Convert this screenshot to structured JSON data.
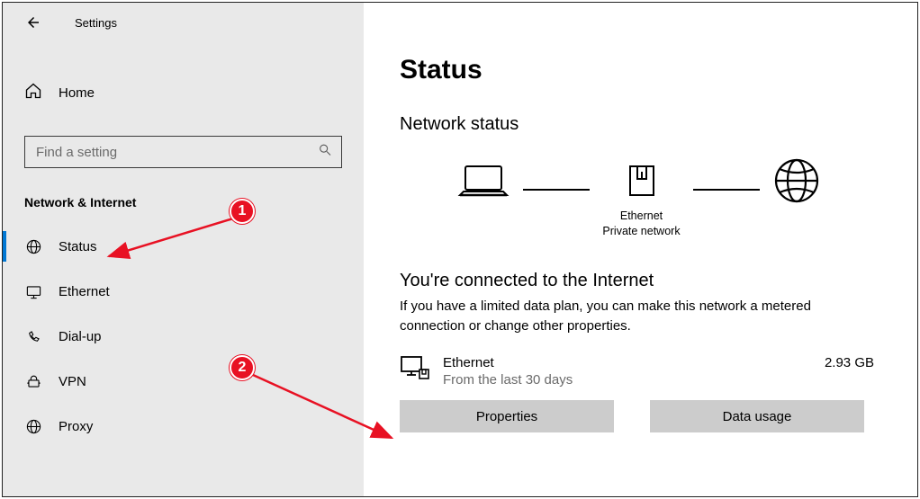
{
  "header": {
    "back_aria": "Back",
    "app_title": "Settings"
  },
  "sidebar": {
    "home": "Home",
    "search_placeholder": "Find a setting",
    "section": "Network & Internet",
    "items": [
      {
        "label": "Status",
        "icon": "globe-icon",
        "active": true
      },
      {
        "label": "Ethernet",
        "icon": "monitor-icon",
        "active": false
      },
      {
        "label": "Dial-up",
        "icon": "dialup-icon",
        "active": false
      },
      {
        "label": "VPN",
        "icon": "vpn-icon",
        "active": false
      },
      {
        "label": "Proxy",
        "icon": "globe-icon",
        "active": false
      }
    ]
  },
  "main": {
    "title": "Status",
    "section_heading": "Network status",
    "diagram": {
      "adapter_name": "Ethernet",
      "adapter_type": "Private network"
    },
    "connected_heading": "You're connected to the Internet",
    "connected_desc": "If you have a limited data plan, you can make this network a metered connection or change other properties.",
    "adapter": {
      "name": "Ethernet",
      "subtitle": "From the last 30 days",
      "usage": "2.93 GB"
    },
    "buttons": {
      "properties": "Properties",
      "data_usage": "Data usage"
    }
  },
  "annotations": {
    "callout1": "1",
    "callout2": "2"
  }
}
